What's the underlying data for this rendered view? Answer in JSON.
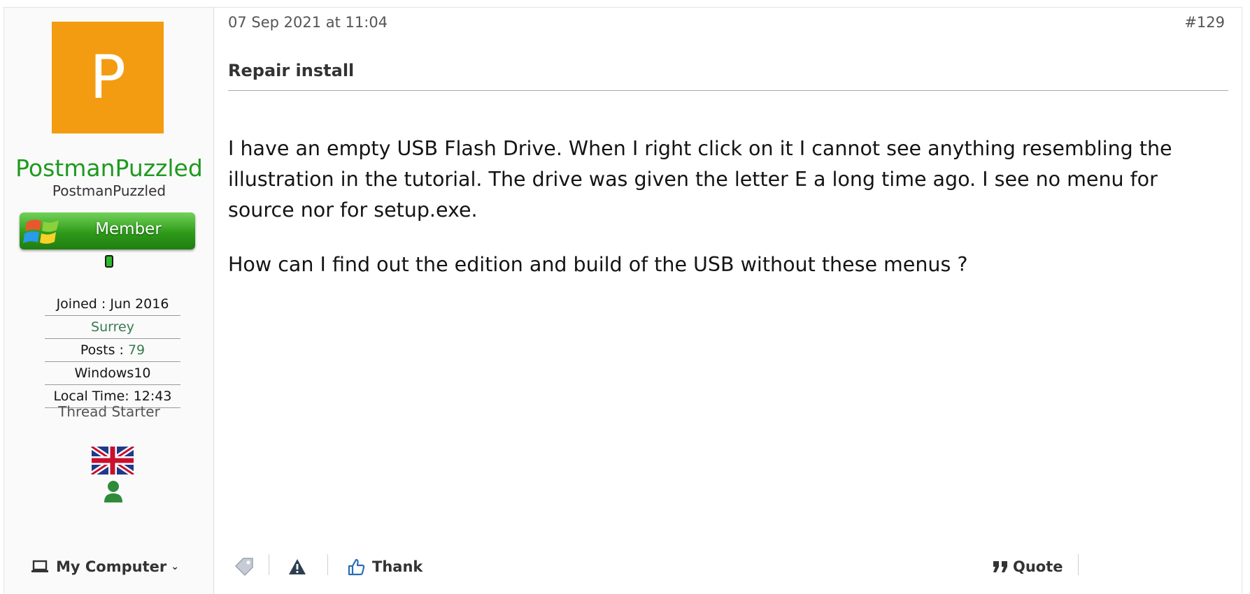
{
  "user": {
    "avatar_letter": "P",
    "avatar_color": "#f39c12",
    "display_name": "PostmanPuzzled",
    "username": "PostmanPuzzled",
    "rank_banner": "Member",
    "status": "online",
    "stats": {
      "joined": "Joined : Jun 2016",
      "location": "Surrey",
      "posts_label": "Posts : ",
      "posts_value": "79",
      "os": "Windows10",
      "local_time": "Local Time: 12:43"
    },
    "role": "Thread Starter",
    "flag_icon": "uk-flag-icon",
    "profile_icon": "user-icon",
    "my_computer": "My Computer"
  },
  "post": {
    "date": "07 Sep 2021 at 11:04",
    "number": "#129",
    "title": "Repair install",
    "paragraphs": [
      "I have an empty USB Flash Drive. When I right click on it I cannot see anything resembling the illustration in the tutorial. The drive was given the letter E a long time ago. I see no menu for source nor for setup.exe.",
      "How can I find out the edition and build of the USB without these menus ?"
    ]
  },
  "actions": {
    "tag_icon": "tag-icon",
    "report_icon": "warning-icon",
    "thank_label": "Thank",
    "quote_label": "Quote"
  },
  "colors": {
    "username": "#1e9a1e",
    "link": "#3a7a50",
    "banner": "#2f9a1a"
  }
}
